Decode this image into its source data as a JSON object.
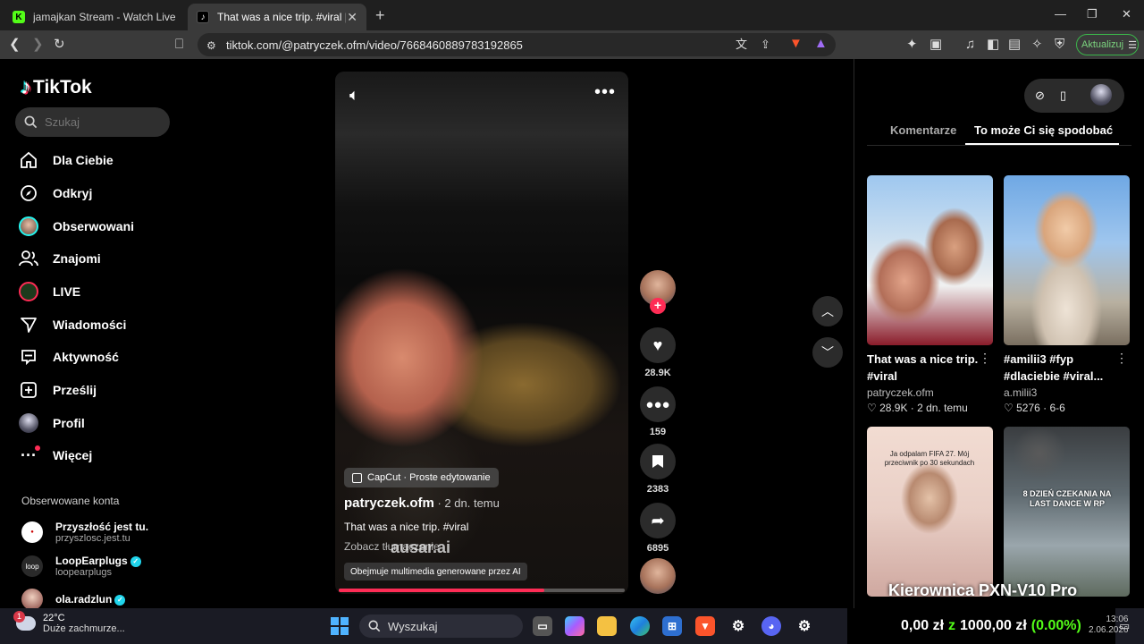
{
  "browser": {
    "tabs": [
      {
        "favicon": "K",
        "title": "jamajkan Stream - Watch Live on Kick"
      },
      {
        "favicon": "♪",
        "title": "That was a nice trip. #viral | TikTok"
      }
    ],
    "url": "tiktok.com/@patryczek.ofm/video/7668460889783192865",
    "update_button": "Aktualizuj"
  },
  "tiktok": {
    "logo": "TikTok",
    "search_placeholder": "Szukaj",
    "nav": [
      {
        "label": "Dla Ciebie",
        "icon": "home-icon"
      },
      {
        "label": "Odkryj",
        "icon": "compass-icon"
      },
      {
        "label": "Obserwowani",
        "icon": "avatar-icon"
      },
      {
        "label": "Znajomi",
        "icon": "friends-icon"
      },
      {
        "label": "LIVE",
        "icon": "live-icon"
      },
      {
        "label": "Wiadomości",
        "icon": "message-icon"
      },
      {
        "label": "Aktywność",
        "icon": "activity-icon"
      },
      {
        "label": "Prześlij",
        "icon": "upload-icon"
      },
      {
        "label": "Profil",
        "icon": "profile-icon"
      },
      {
        "label": "Więcej",
        "icon": "more-icon"
      }
    ],
    "following_heading": "Obserwowane konta",
    "following": [
      {
        "name": "Przyszłość jest tu.",
        "handle": "przyszlosc.jest.tu",
        "verified": false
      },
      {
        "name": "LoopEarplugs",
        "handle": "loopearplugs",
        "verified": true,
        "avatar_text": "loop"
      },
      {
        "name": "ola.radzlun",
        "handle": "",
        "verified": true
      }
    ],
    "video": {
      "capcut": "CapCut · Proste edytowanie",
      "author": "patryczek.ofm",
      "date": " · 2 dn. temu",
      "caption": "That was a nice trip. #viral",
      "translate": "Zobacz tłumaczenie",
      "watermark": "ausar.ai",
      "ai_label": "Obejmuje multimedia generowane przez AI",
      "progress_pct": 72
    },
    "actions": {
      "likes": "28.9K",
      "comments": "159",
      "saves": "2383",
      "shares": "6895"
    },
    "right_panel": {
      "tab_comments": "Komentarze",
      "tab_recommended": "To może Ci się spodobać",
      "cards": [
        {
          "title": "That was a nice trip. #viral",
          "author": "patryczek.ofm",
          "likes": "28.9K",
          "date": "2 dn. temu"
        },
        {
          "title": "#amilii3 #fyp #dlaciebie #viral...",
          "author": "a.milii3",
          "likes": "5276",
          "date": "6-6"
        },
        {
          "thumb_text": "Ja odpalam FIFA 27. Mój przeciwnik po 30 sekundach"
        },
        {
          "thumb_text": "8 DZIEŃ CZEKANIA NA LAST DANCE W RP"
        }
      ]
    },
    "promo_overlay": "Kierownica PXN-V10 Pro"
  },
  "taskbar": {
    "weather_badge": "1",
    "temperature": "22°C",
    "weather_desc": "Duże zachmurze...",
    "search": "Wyszukaj",
    "stream_overlay": {
      "left": "0,00 zł",
      "mid": "z",
      "right": "1000,00 zł",
      "pct": "(0.00%)"
    },
    "time": "13:06",
    "date": "2.06.2026"
  },
  "colors": {
    "accent": "#fe2c55",
    "kick_green": "#53fc18",
    "teal": "#25f4ee"
  }
}
